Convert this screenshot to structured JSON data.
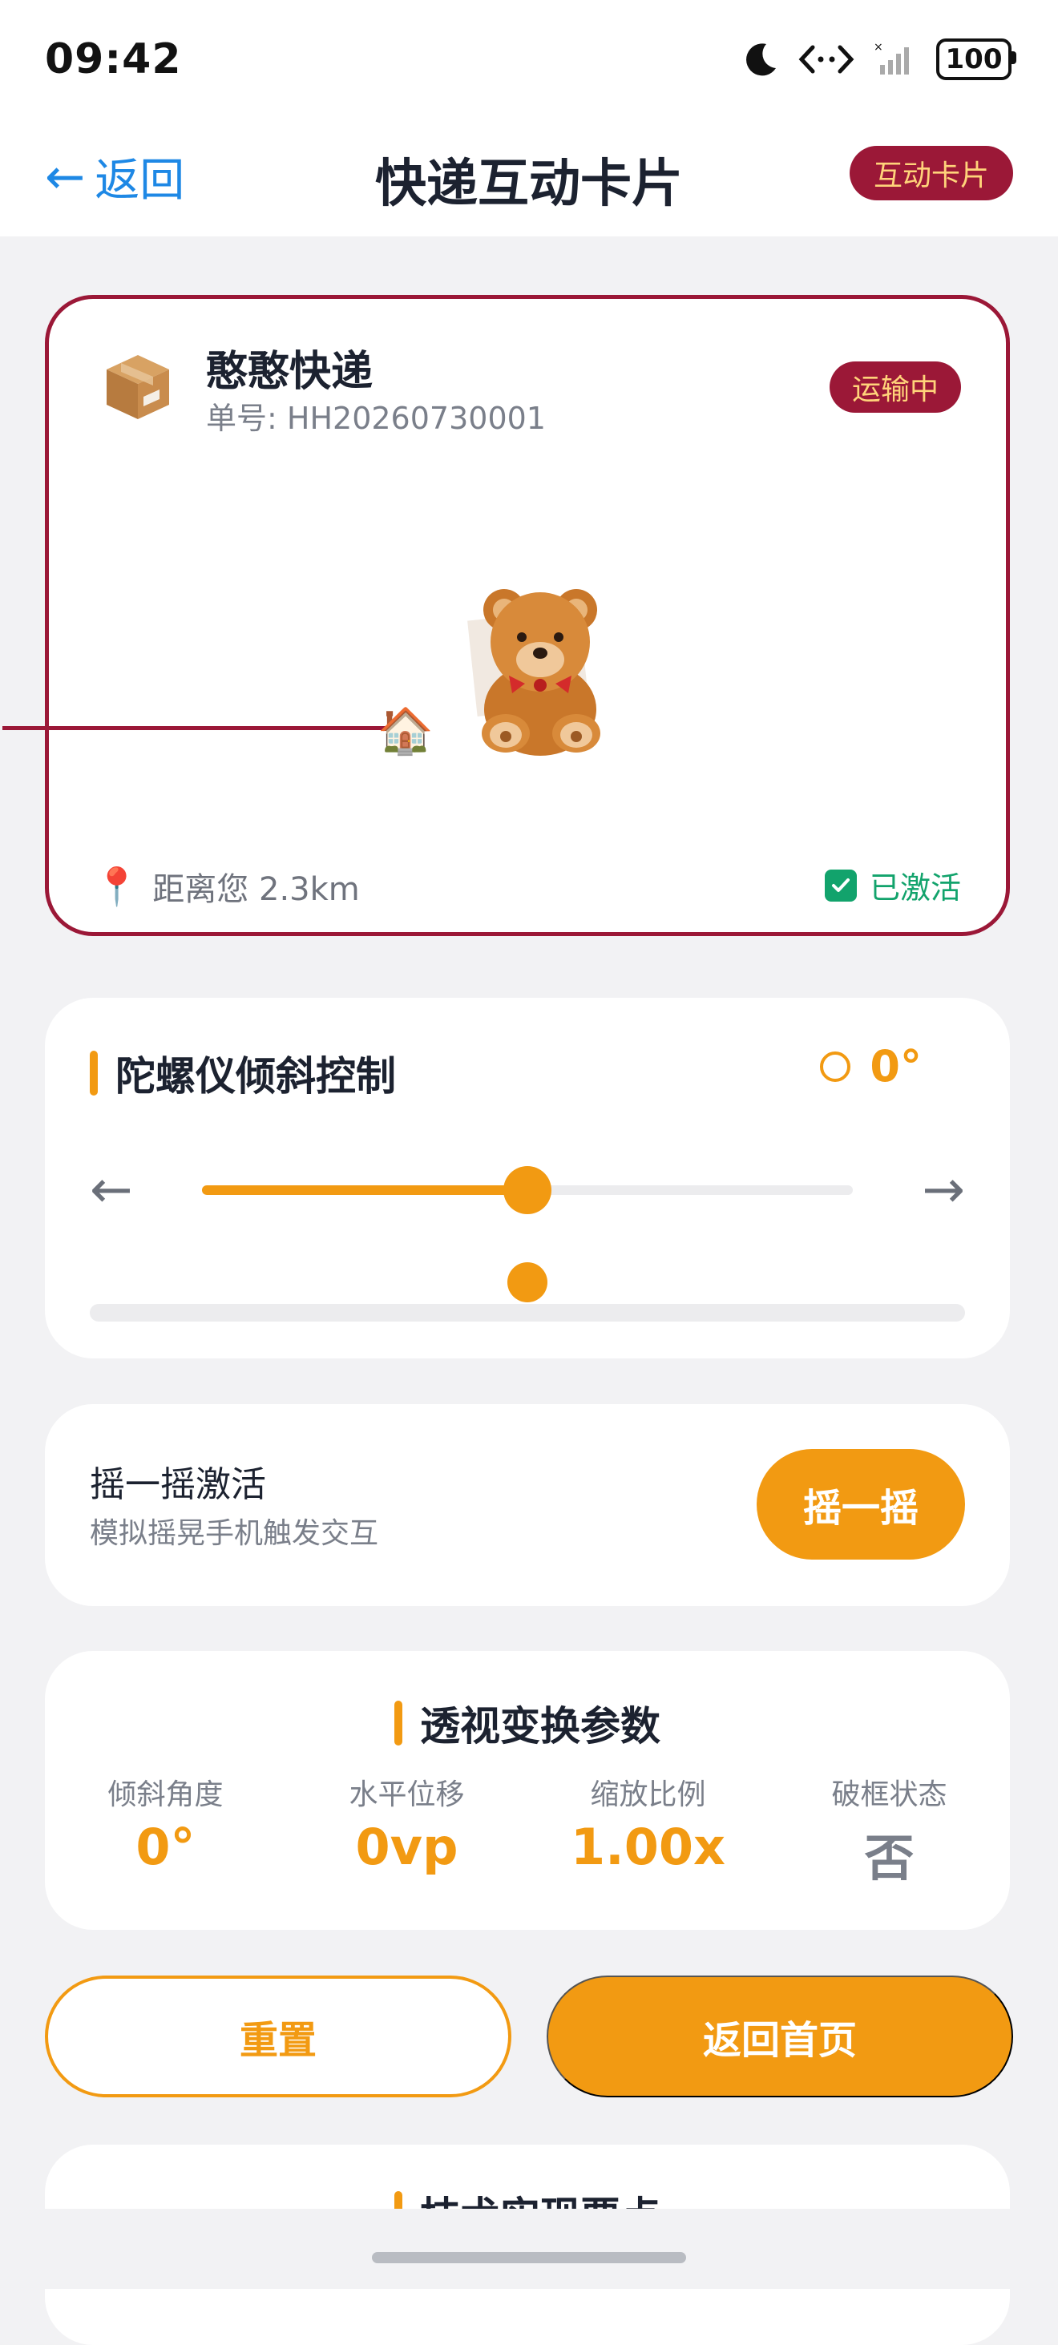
{
  "status_bar": {
    "time": "09:42",
    "battery": "100"
  },
  "nav": {
    "back_arrow": "←",
    "back_label": "返回",
    "title": "快递互动卡片",
    "badge": "互动卡片"
  },
  "package_card": {
    "carrier": "憨憨快递",
    "tracking": "单号: HH20260730001",
    "status": "运输中",
    "distance": "距离您 2.3km",
    "activated": "已激活",
    "icons": {
      "package": "package-icon",
      "house": "house-icon",
      "bear": "teddy-bear-icon",
      "pin": "location-pin-icon",
      "check": "check-icon"
    }
  },
  "gyro": {
    "title": "陀螺仪倾斜控制",
    "value": "0°",
    "slider_fraction": 0.5,
    "level_fraction": 0.5,
    "left_arrow": "←",
    "right_arrow": "→"
  },
  "shake": {
    "title": "摇一摇激活",
    "subtitle": "模拟摇晃手机触发交互",
    "button": "摇一摇"
  },
  "params": {
    "title": "透视变换参数",
    "items": [
      {
        "label": "倾斜角度",
        "value": "0°"
      },
      {
        "label": "水平位移",
        "value": "0vp"
      },
      {
        "label": "缩放比例",
        "value": "1.00x"
      },
      {
        "label": "破框状态",
        "value": "否"
      }
    ]
  },
  "actions": {
    "reset": "重置",
    "home": "返回首页"
  },
  "tech": {
    "title": "技术实现要点"
  },
  "colors": {
    "accent": "#f29a12",
    "brand": "#9b1837",
    "link": "#1e88e5",
    "success": "#12a36c"
  }
}
